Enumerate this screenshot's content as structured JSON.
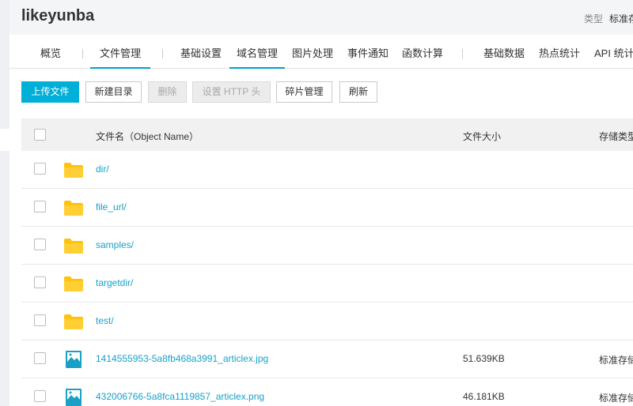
{
  "app_title": "likeyunba",
  "meta": {
    "type_label": "类型",
    "type_value": "标准存储"
  },
  "tabs": [
    {
      "label": "概览"
    },
    {
      "label": "文件管理"
    },
    {
      "label": "基础设置"
    },
    {
      "label": "域名管理"
    },
    {
      "label": "图片处理"
    },
    {
      "label": "事件通知"
    },
    {
      "label": "函数计算"
    },
    {
      "label": "基础数据"
    },
    {
      "label": "热点统计"
    },
    {
      "label": "API 统计"
    }
  ],
  "toolbar": {
    "upload": "上传文件",
    "new_dir": "新建目录",
    "delete": "删除",
    "set_http": "设置 HTTP 头",
    "fragments": "碎片管理",
    "refresh": "刷新"
  },
  "table": {
    "columns": {
      "name": "文件名（Object Name）",
      "size": "文件大小",
      "storage": "存储类型"
    },
    "rows": [
      {
        "name": "dir/",
        "size": "",
        "storage": "",
        "icon": "folder-icon"
      },
      {
        "name": "file_url/",
        "size": "",
        "storage": "",
        "icon": "folder-icon"
      },
      {
        "name": "samples/",
        "size": "",
        "storage": "",
        "icon": "folder-icon"
      },
      {
        "name": "targetdir/",
        "size": "",
        "storage": "",
        "icon": "folder-icon"
      },
      {
        "name": "test/",
        "size": "",
        "storage": "",
        "icon": "folder-icon"
      },
      {
        "name": "1414555953-5a8fb468a3991_articlex.jpg",
        "size": "51.639KB",
        "storage": "标准存储",
        "icon": "image-file-icon"
      },
      {
        "name": "432006766-5a8fca1119857_articlex.png",
        "size": "46.181KB",
        "storage": "标准存储",
        "icon": "image-file-icon"
      }
    ]
  },
  "colors": {
    "accent": "#00b0d8",
    "link": "#16a2c9",
    "folder": "#ffc20e"
  }
}
